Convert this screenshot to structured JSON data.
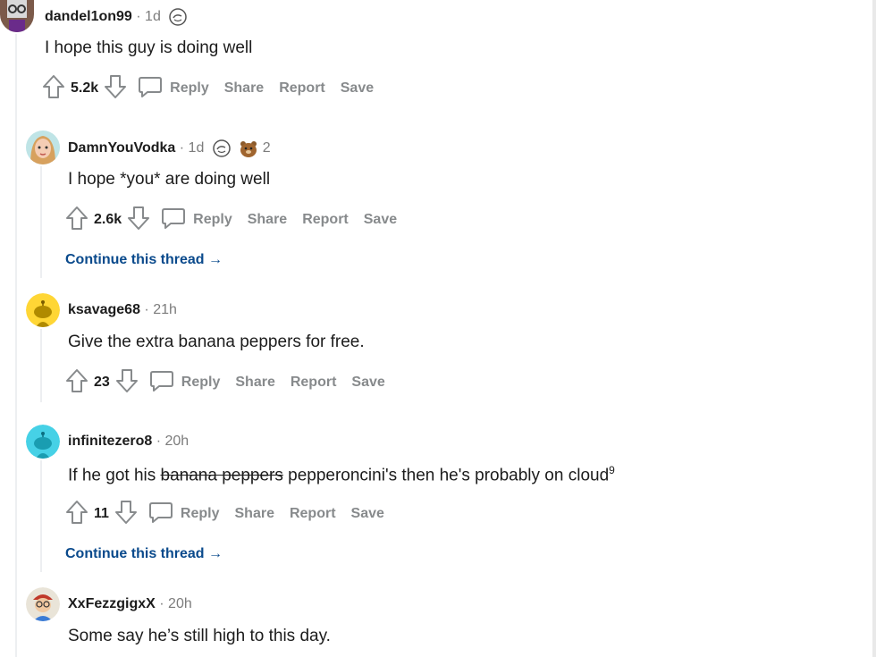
{
  "comments": [
    {
      "username": "dandel1on99",
      "age": "1d",
      "award_count": "",
      "body": "I hope this guy is doing well",
      "score": "5.2k",
      "continue_label": ""
    },
    {
      "username": "DamnYouVodka",
      "age": "1d",
      "award_count": "2",
      "body": "I hope *you* are doing well",
      "score": "2.6k",
      "continue_label": "Continue this thread"
    },
    {
      "username": "ksavage68",
      "age": "21h",
      "award_count": "",
      "body": "Give the extra banana peppers for free.",
      "score": "23",
      "continue_label": ""
    },
    {
      "username": "infinitezero8",
      "age": "20h",
      "award_count": "",
      "body_prefix": "If he got his ",
      "body_strike": "banana peppers",
      "body_suffix": " pepperoncini's then he's probably on cloud",
      "body_sup": "9",
      "score": "11",
      "continue_label": "Continue this thread"
    },
    {
      "username": "XxFezzgigxX",
      "age": "20h",
      "award_count": "",
      "body": "Some say he’s still high to this day.",
      "score": "",
      "continue_label": ""
    }
  ],
  "actions": {
    "reply": "Reply",
    "share": "Share",
    "report": "Report",
    "save": "Save"
  },
  "separator": "·",
  "continue_arrow": "→",
  "icons": {
    "upvote": "upvote-arrow-icon",
    "downvote": "downvote-arrow-icon",
    "reply": "speech-bubble-icon",
    "award_helpful": "hand-award-icon",
    "award_bear": "bear-award-icon"
  },
  "colors": {
    "action_gray": "#878a8c",
    "link_blue": "#0a4a8c",
    "thread_line": "#edeff1"
  }
}
